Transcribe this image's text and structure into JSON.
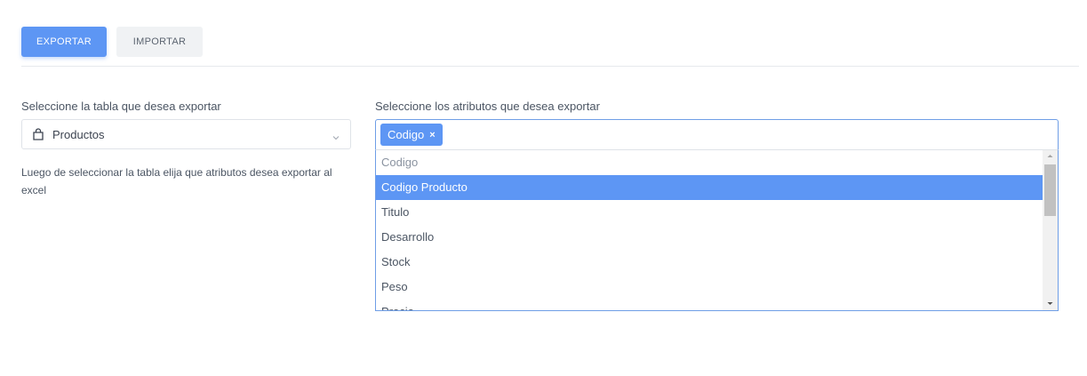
{
  "tabs": {
    "export_label": "EXPORTAR",
    "import_label": "IMPORTAR"
  },
  "table_section": {
    "label": "Seleccione la tabla que desea exportar",
    "selected_value": "Productos",
    "icon": "shopping-bag-icon",
    "help_text": "Luego de seleccionar la tabla elija que atributos desea exportar al excel"
  },
  "attributes_section": {
    "label": "Seleccione los atributos que desea exportar",
    "selected_tags": [
      "Codigo"
    ],
    "tag_remove_glyph": "×",
    "options": [
      "Codigo",
      "Codigo Producto",
      "Titulo",
      "Desarrollo",
      "Stock",
      "Peso",
      "Precio"
    ],
    "highlighted_option": "Codigo Producto"
  },
  "colors": {
    "accent": "#5d96f4",
    "inactive_button": "#f0f2f4",
    "border": "#dfe3e8",
    "focus_border": "#6f9ee6"
  }
}
